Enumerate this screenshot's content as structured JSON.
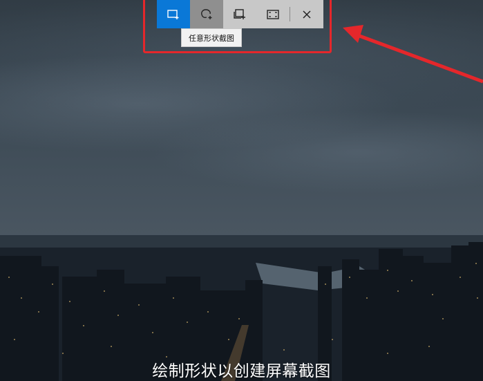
{
  "toolbar": {
    "tools": [
      {
        "id": "rectangle",
        "icon": "rectangle-snip-icon",
        "state": "selected"
      },
      {
        "id": "freeform",
        "icon": "freeform-snip-icon",
        "state": "hover"
      },
      {
        "id": "window",
        "icon": "window-snip-icon",
        "state": "normal"
      },
      {
        "id": "fullscreen",
        "icon": "fullscreen-snip-icon",
        "state": "normal"
      }
    ],
    "close_icon": "close-icon"
  },
  "tooltip": {
    "text": "任意形状截图"
  },
  "caption": {
    "text": "绘制形状以创建屏幕截图"
  },
  "colors": {
    "selected": "#0a78d7",
    "hover": "#8f8f8f",
    "toolbar_bg": "#c8c8c8",
    "annotation": "#e5272b"
  }
}
